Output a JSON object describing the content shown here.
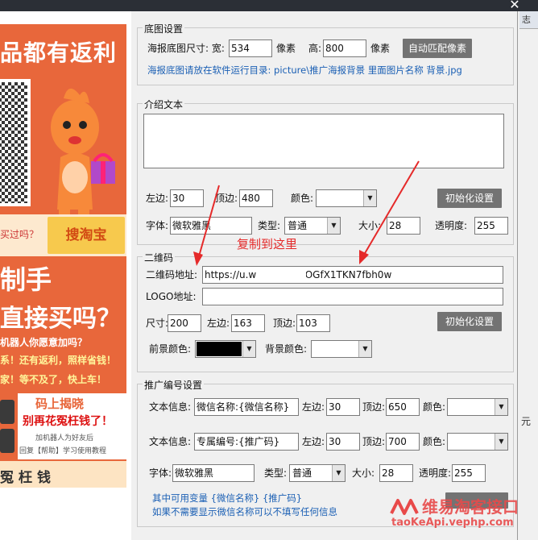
{
  "poster": {
    "headline": "品都有返利",
    "ask": "买过吗？",
    "search_btn": "搜淘宝",
    "big1": "制手",
    "big2": "直接买吗？",
    "small1": "机器人你愿意加吗？",
    "small2": "系！还有返利，照样省钱！",
    "small3": "家！等不及了，快上车！",
    "card_t1": "码上揭晓",
    "card_t2": "别再花冤枉钱了！",
    "card_t3": "加机器人为好友后",
    "card_t4": "回复【帮助】学习使用教程",
    "footer": "冤枉钱"
  },
  "right_window": {
    "tab": "志",
    "text": "元"
  },
  "bg_group": {
    "title": "底图设置",
    "size_label": "海报底图尺寸: 宽:",
    "width": "534",
    "unit1": "像素",
    "height_label": "高:",
    "height": "800",
    "unit2": "像素",
    "auto_btn": "自动匹配像素",
    "hint": "海报底图请放在软件运行目录: picture\\推广海报背景 里面图片名称 背景.jpg"
  },
  "intro_group": {
    "title": "介绍文本",
    "left_label": "左边:",
    "left": "30",
    "top_label": "顶边:",
    "top": "480",
    "color_label": "颜色:",
    "init_btn": "初始化设置",
    "font_label": "字体:",
    "font": "微软雅黑",
    "type_label": "类型:",
    "type": "普通",
    "size_label": "大小:",
    "size": "28",
    "opacity_label": "透明度:",
    "opacity": "255"
  },
  "annotation": "复制到这里",
  "qr_group": {
    "title": "二维码",
    "url_label": "二维码地址:",
    "url": "https://u.w                    5tmeGSROGfX1TKN7fbh0w",
    "logo_label": "LOGO地址:",
    "logo": "",
    "size_label": "尺寸:",
    "size": "200",
    "left_label": "左边:",
    "left": "163",
    "top_label": "顶边:",
    "top": "103",
    "init_btn": "初始化设置",
    "fg_label": "前景颜色:",
    "bg_label": "背景颜色:",
    "fg_color": "#000000",
    "bg_color": "#ffffff"
  },
  "promo_group": {
    "title": "推广编号设置",
    "row1": {
      "label": "文本信息:",
      "text": "微信名称:{微信名称}",
      "left_label": "左边:",
      "left": "30",
      "top_label": "顶边:",
      "top": "650",
      "color_label": "颜色:"
    },
    "row2": {
      "label": "文本信息:",
      "text": "专属编号:{推广码}",
      "left_label": "左边:",
      "left": "30",
      "top_label": "顶边:",
      "top": "700",
      "color_label": "颜色:"
    },
    "font_label": "字体:",
    "font": "微软雅黑",
    "type_label": "类型:",
    "type": "普通",
    "size_label": "大小:",
    "size": "28",
    "opacity_label": "透明度:",
    "opacity": "255",
    "vars_note": "其中可用变量 {微信名称} {推广码}",
    "empty_note": "如果不需要显示微信名称可以不填写任何信息"
  },
  "watermark": {
    "title": "维易淘客接口",
    "url": "taoKeApi.vephp.com"
  }
}
